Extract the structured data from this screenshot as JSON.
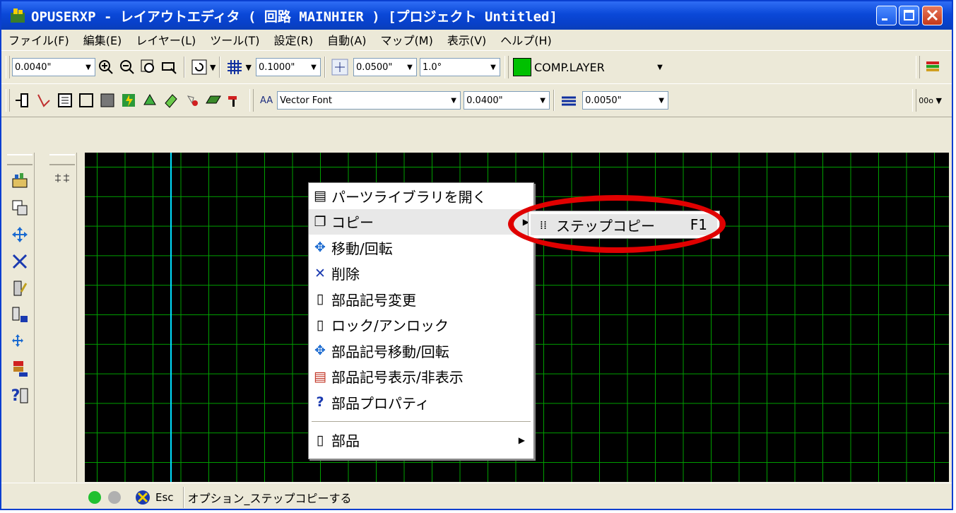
{
  "window": {
    "title": "OPUSERXP - レイアウトエディタ ( 回路 MAINHIER ) [プロジェクト Untitled]"
  },
  "menu": [
    "ファイル(F)",
    "編集(E)",
    "レイヤー(L)",
    "ツール(T)",
    "設定(R)",
    "自動(A)",
    "マップ(M)",
    "表示(V)",
    "ヘルプ(H)"
  ],
  "toolbar1": {
    "zoom_value": "0.0040\"",
    "grid_value": "0.1000\"",
    "snap_value": "0.0500\"",
    "angle_value": "1.0°",
    "layer_name": "COMP.LAYER",
    "layer_color": "#00c000"
  },
  "toolbar2": {
    "font_value": "Vector Font",
    "font_size": "0.0400\"",
    "line_width": "0.0050\"",
    "aa_label": "AA",
    "tail_label": "00o"
  },
  "context_menu": {
    "items": [
      {
        "label": "パーツライブラリを開く",
        "icon": "library-icon"
      },
      {
        "label": "コピー",
        "icon": "copy-icon"
      },
      {
        "label": "移動/回転",
        "icon": "move-icon"
      },
      {
        "label": "削除",
        "icon": "delete-icon"
      },
      {
        "label": "部品記号変更",
        "icon": "edit-symbol-icon"
      },
      {
        "label": "ロック/アンロック",
        "icon": "lock-icon"
      },
      {
        "label": "部品記号移動/回転",
        "icon": "move-symbol-icon"
      },
      {
        "label": "部品記号表示/非表示",
        "icon": "show-hide-icon"
      },
      {
        "label": "部品プロパティ",
        "icon": "properties-icon"
      }
    ],
    "last_item": "部品"
  },
  "submenu": {
    "label": "ステップコピー",
    "shortcut": "F1"
  },
  "statusbar": {
    "esc_label": "Esc",
    "message": "オプション_ステップコピーする"
  },
  "colors": {
    "canvas_bg": "#000000",
    "grid": "#00a000",
    "cursor_line": "#00e0ff",
    "highlight_circle": "#e00000",
    "titlebar": "#0a48d8"
  }
}
